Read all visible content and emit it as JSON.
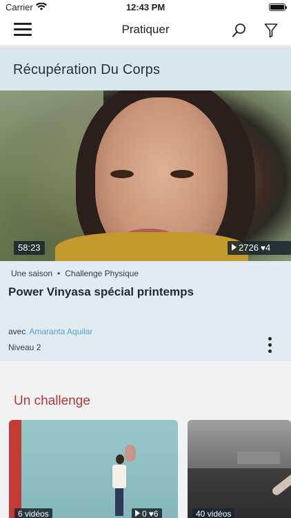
{
  "status_bar": {
    "carrier": "Carrier",
    "time": "12:43 PM"
  },
  "nav": {
    "title": "Pratiquer",
    "menu_icon": "hamburger-icon",
    "search_icon": "search-icon",
    "filter_icon": "filter-icon"
  },
  "section": {
    "title": "Récupération Du Corps"
  },
  "featured": {
    "duration": "58:23",
    "views": "2726",
    "likes": "4",
    "season": "Une saison",
    "category": "Challenge Physique",
    "title": "Power Vinyasa spécial printemps",
    "with_label": "avec",
    "teacher": "Amaranta Aquilar",
    "level": "Niveau 2"
  },
  "challenge": {
    "heading": "Un challenge",
    "tiles": [
      {
        "count": "6 vidéos",
        "views": "0",
        "likes": "6"
      },
      {
        "count": "40 vidéos"
      }
    ]
  },
  "colors": {
    "accent_red": "#b0383b",
    "link_blue": "#5b9ec4",
    "section_bg": "#d9e6ee",
    "card_bg": "#e1ecf2"
  }
}
